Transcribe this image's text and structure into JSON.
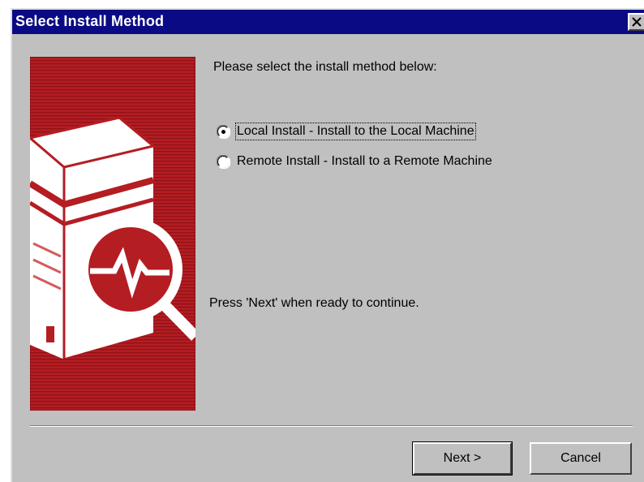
{
  "window": {
    "title": "Select Install Method",
    "titlebar_color": "#0a0a84",
    "background_color": "#c0c0c0"
  },
  "banner": {
    "background_color": "#b51f1f",
    "image": "server-magnifier-illustration"
  },
  "prompt": "Please select the install method below:",
  "options": [
    {
      "label": "Local Install - Install to the Local Machine",
      "selected": true
    },
    {
      "label": "Remote Install - Install to a Remote Machine",
      "selected": false
    }
  ],
  "instruction": "Press 'Next' when ready to continue.",
  "buttons": {
    "next": "Next >",
    "cancel": "Cancel"
  }
}
